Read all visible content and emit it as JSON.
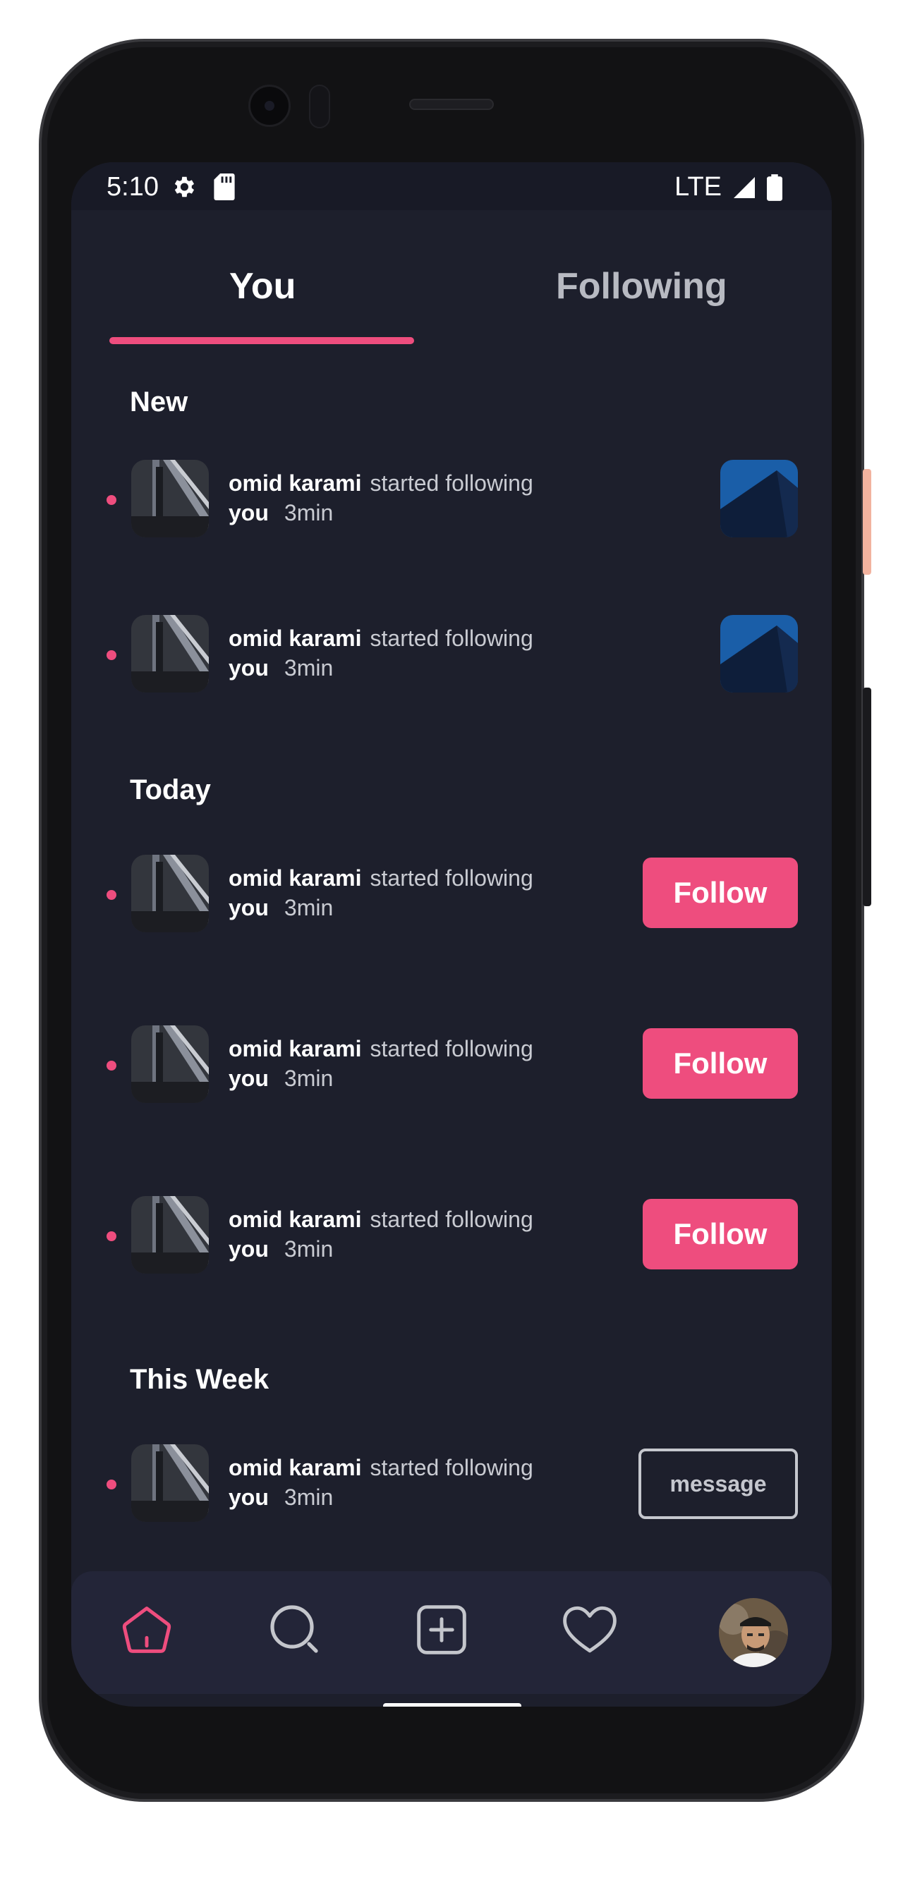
{
  "status_bar": {
    "time": "5:10",
    "network": "LTE"
  },
  "tabs": [
    {
      "label": "You",
      "active": true
    },
    {
      "label": "Following",
      "active": false
    }
  ],
  "sections": {
    "new": "New",
    "today": "Today",
    "this_week": "This Week"
  },
  "notifications": {
    "new": [
      {
        "name": "omid karami",
        "action": "started following",
        "target": "you",
        "time": "3min"
      },
      {
        "name": "omid karami",
        "action": "started following",
        "target": "you",
        "time": "3min"
      }
    ],
    "today": [
      {
        "name": "omid karami",
        "action": "started following",
        "target": "you",
        "time": "3min",
        "button": "Follow"
      },
      {
        "name": "omid karami",
        "action": "started following",
        "target": "you",
        "time": "3min",
        "button": "Follow"
      },
      {
        "name": "omid karami",
        "action": "started following",
        "target": "you",
        "time": "3min",
        "button": "Follow"
      }
    ],
    "this_week": [
      {
        "name": "omid karami",
        "action": "started following",
        "target": "you",
        "time": "3min",
        "button": "message"
      }
    ]
  },
  "bottom_nav": {
    "items": [
      "home-icon",
      "search-icon",
      "add-icon",
      "heart-icon",
      "profile-avatar"
    ],
    "active": "home-icon"
  },
  "colors": {
    "accent": "#ee4d7e",
    "background": "#1d1f2c",
    "nav_background": "#232538",
    "text_muted": "#c9cbd2"
  }
}
